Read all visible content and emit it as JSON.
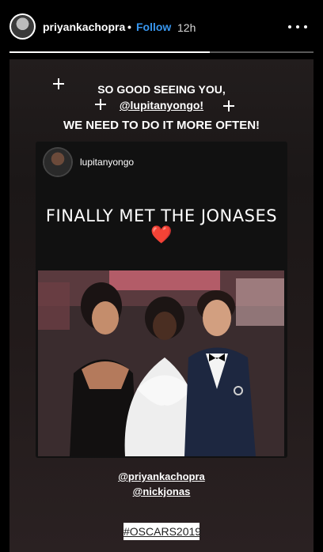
{
  "header": {
    "username": "priyankachopra",
    "separator": "•",
    "follow_label": "Follow",
    "time": "12h",
    "progress": 0.66
  },
  "story": {
    "caption_line1": "SO GOOD SEEING YOU,",
    "caption_mention": "@lupitanyongo!",
    "caption_line3": "WE NEED TO DO IT MORE OFTEN!",
    "post": {
      "username": "lupitanyongo",
      "text": "FINALLY MET THE JONASES",
      "heart": "❤️"
    },
    "mention1": "@priyankachopra",
    "mention2": "@nickjonas",
    "hashtag": "#OSCARS2019"
  }
}
